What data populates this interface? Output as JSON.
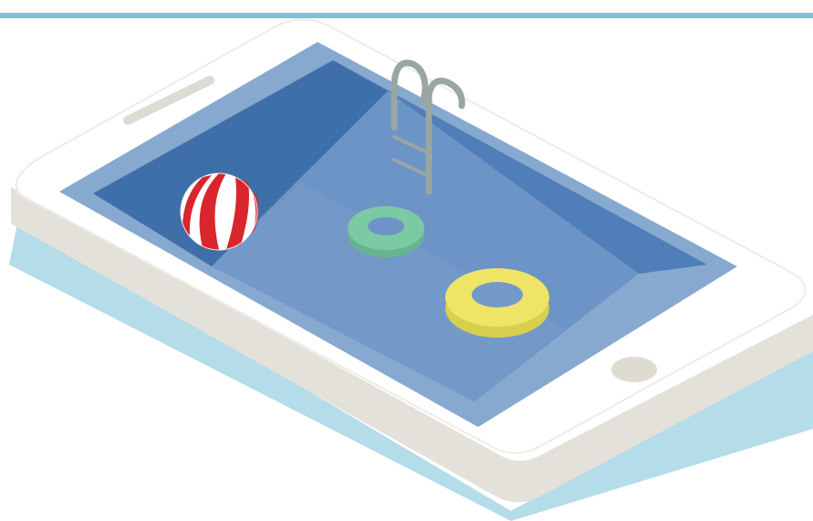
{
  "colors": {
    "accent_bar": "#7fc1d6",
    "phone_body": "#ffffff",
    "phone_edge": "#e4e1da",
    "phone_shadow": "#9bd0e2",
    "pool_rim": "#87a9cf",
    "pool_wall_dark": "#3f6fa8",
    "pool_wall_mid": "#4f7eb8",
    "pool_floor": "#6d94c6",
    "ladder": "#9aa6a0",
    "ball_red": "#d8262c",
    "ball_white": "#ffffff",
    "ring_green": "#7ccaa4",
    "ring_yellow": "#efe466",
    "speaker_slot": "#dedbd3",
    "home_button": "#dedbd3"
  },
  "icons": [
    "smartphone-icon",
    "swimming-pool-icon",
    "pool-ladder-icon",
    "beach-ball-icon",
    "swim-ring-icon"
  ]
}
